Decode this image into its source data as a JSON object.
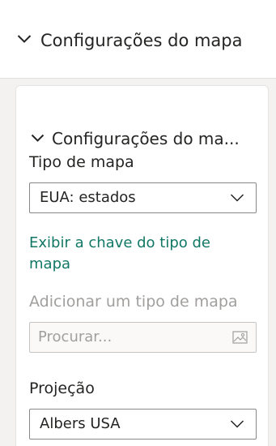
{
  "section": {
    "title": "Configurações do mapa",
    "icon": "chevron-down-icon"
  },
  "card": {
    "title": "Configurações do ma...",
    "icon": "chevron-down-icon"
  },
  "map_type": {
    "label": "Tipo de mapa",
    "value": "EUA: estados",
    "icon": "chevron-down-icon"
  },
  "map_key_link": {
    "label": "Exibir a chave do tipo de mapa"
  },
  "add_map_type": {
    "label": "Adicionar um tipo de mapa",
    "placeholder": "Procurar...",
    "icon": "image-icon"
  },
  "projection": {
    "label": "Projeção",
    "value": "Albers USA",
    "icon": "chevron-down-icon"
  },
  "colors": {
    "link": "#117865",
    "text": "#252423",
    "disabled": "#a19f9d",
    "pane_bg": "#f3f2f1"
  }
}
